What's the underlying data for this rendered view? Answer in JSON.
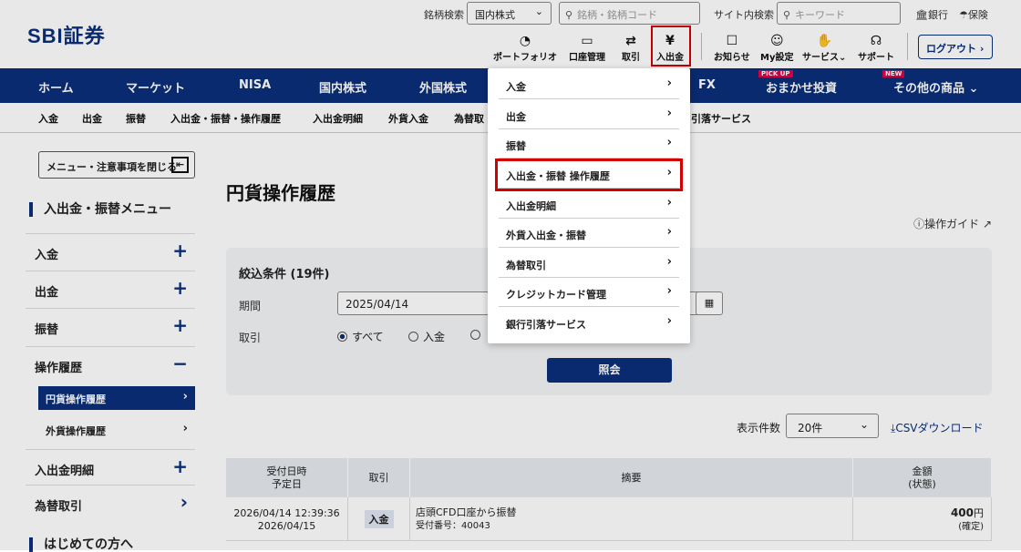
{
  "header": {
    "logo": "SBI証券",
    "search_label": "銘柄検索",
    "market_select": "国内株式",
    "search_placeholder": "銘柄・銘柄コード",
    "site_search_label": "サイト内検索",
    "keyword_placeholder": "キーワード",
    "bank_link": "銀行",
    "insurance_link": "保険",
    "icons": [
      {
        "label": "ポートフォリオ",
        "icon": "pie-icon"
      },
      {
        "label": "口座管理",
        "icon": "card-icon"
      },
      {
        "label": "取引",
        "icon": "exchange-icon"
      },
      {
        "label": "入出金",
        "icon": "yen-icon"
      },
      {
        "label": "お知らせ",
        "icon": "message-icon"
      },
      {
        "label": "My設定",
        "icon": "user-icon"
      },
      {
        "label": "サービス",
        "icon": "hand-coin-icon"
      },
      {
        "label": "サポート",
        "icon": "headset-icon"
      }
    ],
    "logout": "ログアウト"
  },
  "nav": {
    "items": [
      "ホーム",
      "マーケット",
      "NISA",
      "国内株式",
      "外国株式",
      "FX",
      "おまかせ投資",
      "その他の商品"
    ],
    "pickup_badge": "PICK UP",
    "new_badge": "NEW"
  },
  "subnav": [
    "入金",
    "出金",
    "振替",
    "入出金・振替・操作履歴",
    "入出金明細",
    "外貨入金",
    "為替取",
    "引落サービス"
  ],
  "sidebar": {
    "close_menu": "メニュー・注意事項を閉じる",
    "title": "入出金・振替メニュー",
    "items": [
      {
        "label": "入金",
        "toggle": "+"
      },
      {
        "label": "出金",
        "toggle": "+"
      },
      {
        "label": "振替",
        "toggle": "+"
      },
      {
        "label": "操作履歴",
        "toggle": "−"
      },
      {
        "label": "入出金明細",
        "toggle": "+"
      },
      {
        "label": "為替取引",
        "toggle": "›"
      }
    ],
    "sub_items": [
      "円貨操作履歴",
      "外貨操作履歴"
    ],
    "beginner": "はじめての方へ"
  },
  "main": {
    "title": "円貨操作履歴",
    "guide": "操作ガイド",
    "filter_title": "絞込条件 (19件)",
    "period_label": "期間",
    "period_value": "2025/04/14",
    "trade_label": "取引",
    "radios": [
      "すべて",
      "入金",
      ""
    ],
    "search_button": "照会",
    "count_label": "表示件数",
    "count_value": "20件",
    "csv": "CSVダウンロード"
  },
  "table": {
    "headers": [
      "受付日時",
      "予定日",
      "取引",
      "摘要",
      "金額",
      "(状態)"
    ],
    "rows": [
      {
        "datetime": "2026/04/14 12:39:36",
        "date": "2026/04/15",
        "type": "入金",
        "desc": "店頭CFD口座から振替",
        "receipt": "受付番号：40043",
        "amount": "400",
        "yen": "円",
        "status": "(確定)"
      }
    ]
  },
  "dropdown": {
    "items": [
      "入金",
      "出金",
      "振替",
      "入出金・振替 操作履歴",
      "入出金明細",
      "外貨入出金・振替",
      "為替取引",
      "クレジットカード管理",
      "銀行引落サービス"
    ]
  }
}
